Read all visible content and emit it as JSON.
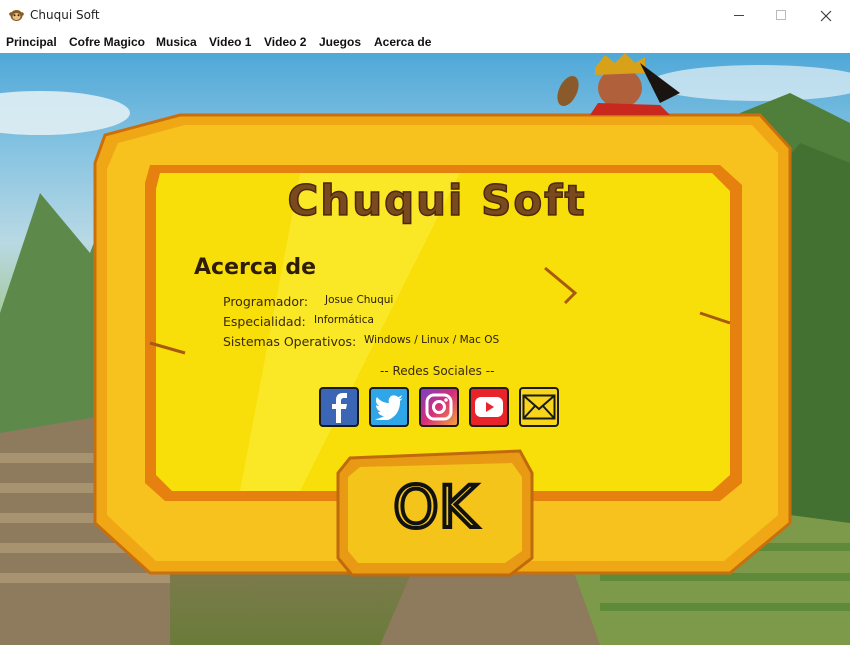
{
  "window": {
    "title": "Chuqui Soft",
    "icon": "monkey-icon"
  },
  "menu": [
    "Principal",
    "Cofre Magico",
    "Musica",
    "Video 1",
    "Video 2",
    "Juegos",
    "Acerca de"
  ],
  "about": {
    "logo_text": "Chuqui Soft",
    "heading": "Acerca de",
    "rows": [
      {
        "label": "Programador:",
        "value": "Josue Chuqui"
      },
      {
        "label": "Especialidad:",
        "value": "Informática"
      },
      {
        "label": "Sistemas Operativos:",
        "value": "Windows / Linux / Mac OS"
      }
    ],
    "social_heading": "-- Redes Sociales --",
    "social_icons": [
      "facebook-icon",
      "twitter-icon",
      "instagram-icon",
      "youtube-icon",
      "email-icon"
    ],
    "ok_label": "OK"
  },
  "colors": {
    "board_gold": "#f5c11a",
    "board_inner": "#f9e40a",
    "board_border": "#e08a12",
    "logo_brown": "#7a4a1e"
  }
}
